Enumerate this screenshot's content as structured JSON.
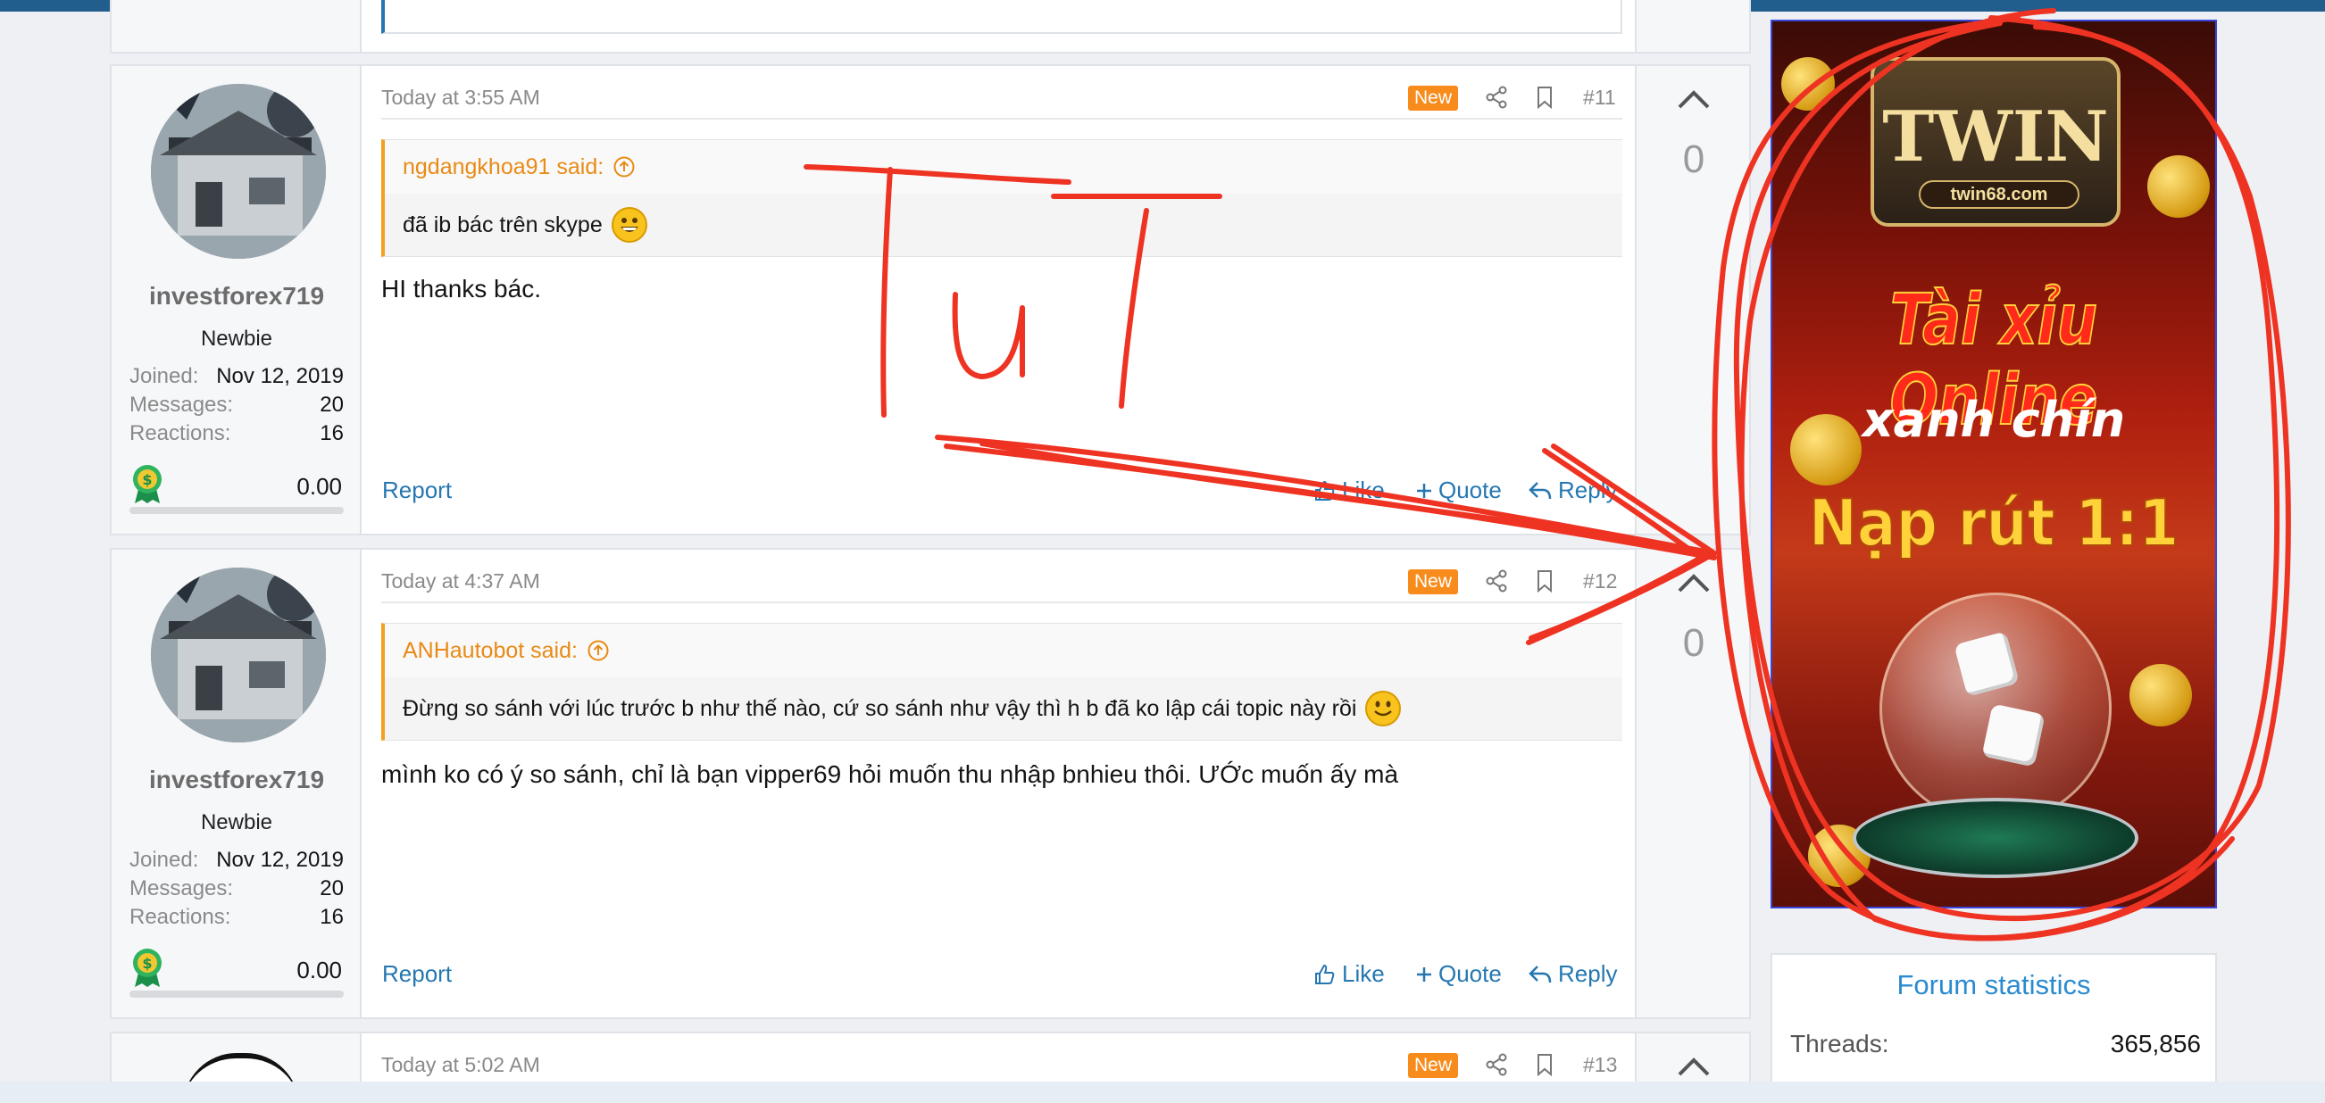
{
  "posts": [
    {
      "user": {
        "name": "investforex719",
        "title": "Newbie",
        "joined_label": "Joined:",
        "joined": "Nov 12, 2019",
        "messages_label": "Messages:",
        "messages": "20",
        "reactions_label": "Reactions:",
        "reactions": "16",
        "balance": "0.00"
      },
      "date": "Today at 3:55 AM",
      "new_label": "New",
      "number": "#11",
      "quote": {
        "author": "ngdangkhoa91 said:",
        "text": "đã ib bác trên skype"
      },
      "text": "HI thanks bác.",
      "report": "Report",
      "like": "Like",
      "quote_btn": "Quote",
      "reply": "Reply",
      "votes": "0"
    },
    {
      "user": {
        "name": "investforex719",
        "title": "Newbie",
        "joined_label": "Joined:",
        "joined": "Nov 12, 2019",
        "messages_label": "Messages:",
        "messages": "20",
        "reactions_label": "Reactions:",
        "reactions": "16",
        "balance": "0.00"
      },
      "date": "Today at 4:37 AM",
      "new_label": "New",
      "number": "#12",
      "quote": {
        "author": "ANHautobot said:",
        "text": "Đừng so sánh với lúc trước b như thế nào, cứ so sánh như vậy thì h b đã ko lập cái topic này rồi"
      },
      "text": "mình ko có ý so sánh, chỉ là bạn vipper69 hỏi muốn thu nhập bnhieu thôi. ƯỚc muốn ấy mà",
      "report": "Report",
      "like": "Like",
      "quote_btn": "Quote",
      "reply": "Reply",
      "votes": "0"
    },
    {
      "date": "Today at 5:02 AM",
      "new_label": "New",
      "number": "#13"
    }
  ],
  "ad": {
    "logo": "TWIN",
    "logo_url": "twin68.com",
    "line1": "Tài xỉu Online",
    "line2": "xanh chín",
    "line3": "Nạp rút 1:1"
  },
  "stats": {
    "title": "Forum statistics",
    "threads_label": "Threads:",
    "threads": "365,856"
  },
  "annotation": {
    "handwriting": "TúT",
    "color": "#ee3322"
  },
  "colors": {
    "accent": "#2577b1",
    "new_badge": "#f78c1d",
    "quote_border": "#f3a022",
    "topbar": "#215e8d"
  }
}
